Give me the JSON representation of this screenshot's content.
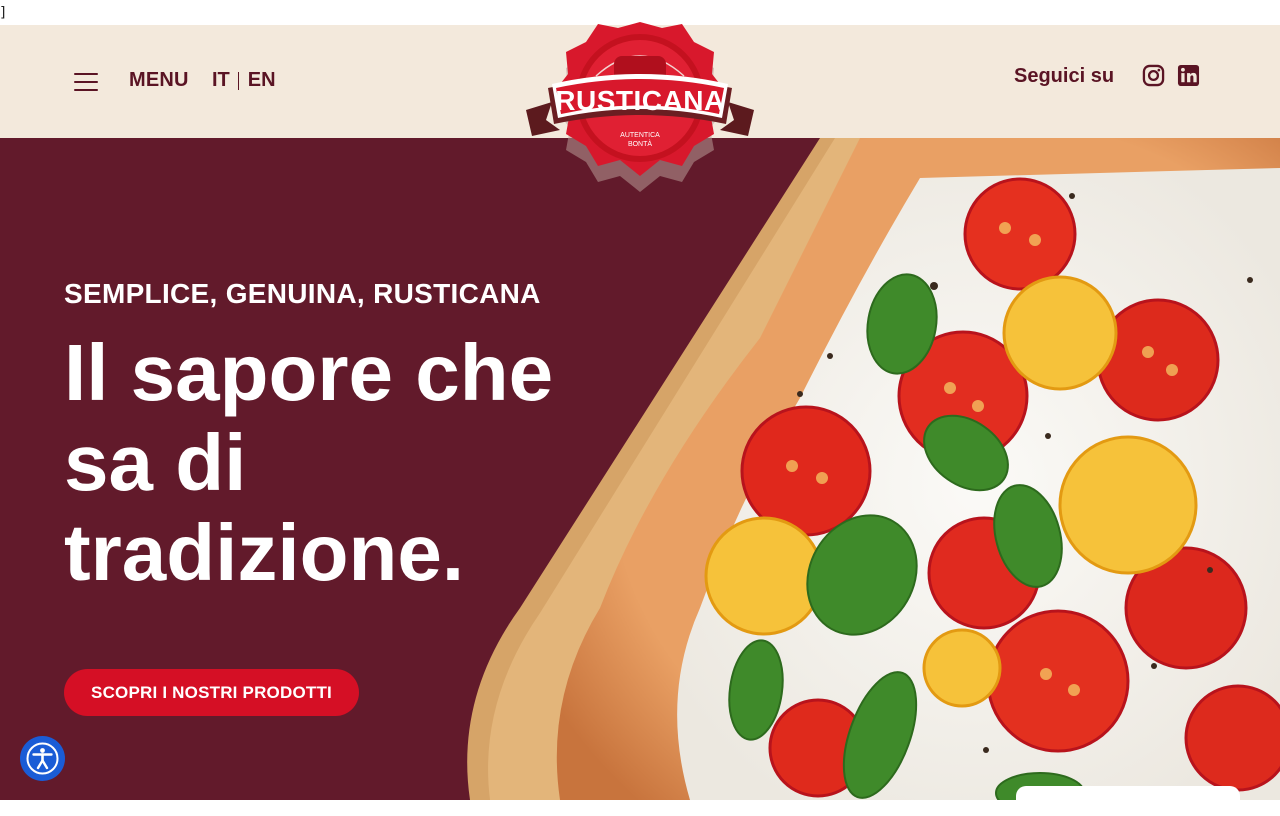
{
  "browser": {
    "fragment": "]"
  },
  "header": {
    "menu_label": "MENU",
    "languages": [
      "IT",
      "EN"
    ],
    "follow_label": "Seguici su",
    "social": [
      "instagram-icon",
      "linkedin-icon"
    ]
  },
  "logo": {
    "brand": "RUSTICANA",
    "tagline_line1": "AUTENTICA",
    "tagline_line2": "BONTÀ"
  },
  "hero": {
    "eyebrow": "SEMPLICE, GENUINA, RUSTICANA",
    "headline_line1": "Il sapore che",
    "headline_line2": "sa di",
    "headline_line3": "tradizione.",
    "cta_label": "SCOPRI I NOSTRI PRODOTTI"
  },
  "widgets": {
    "accessibility_icon": "accessibility-icon"
  },
  "colors": {
    "header_bg": "#f3e9dc",
    "hero_bg": "#621a2b",
    "accent_red": "#d50f25",
    "text_dark": "#5a1424"
  }
}
